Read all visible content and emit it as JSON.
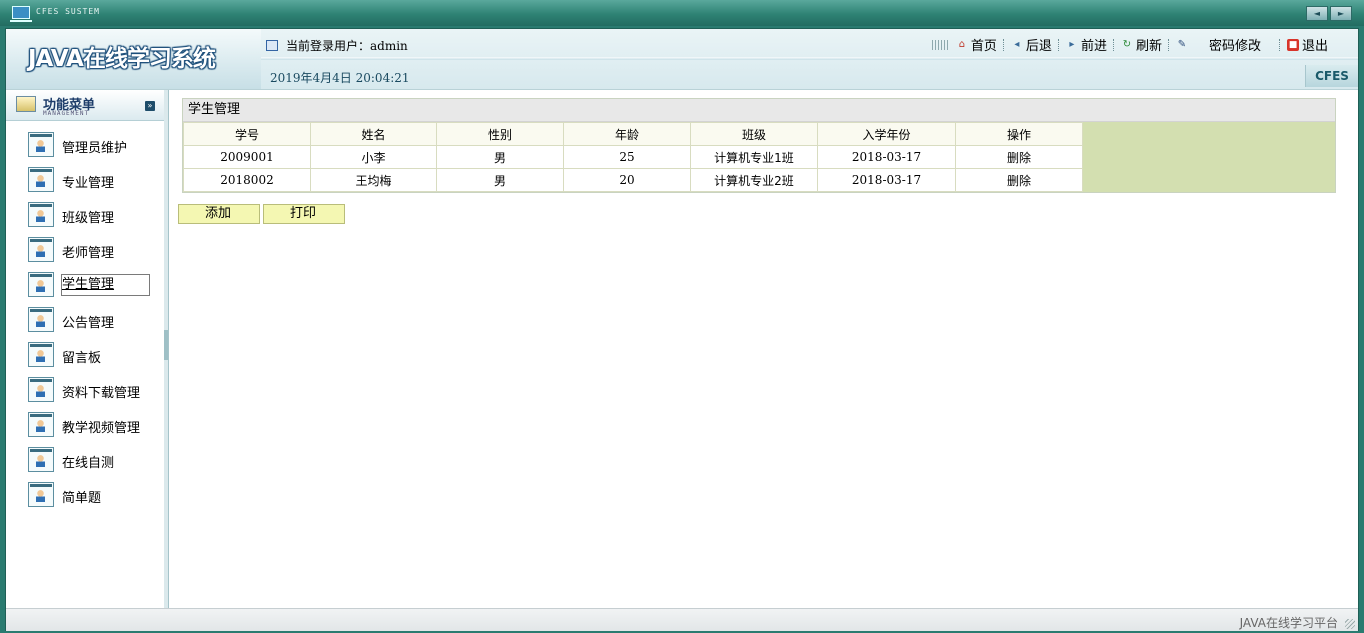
{
  "window": {
    "title": "CFES SUSTEM",
    "nav_buttons": [
      "◄",
      "►"
    ]
  },
  "header": {
    "logo": "JAVA在线学习系统",
    "current_user_label": "当前登录用户：admin",
    "date": "2019年4月4日  20:04:21",
    "brand_tag": "CFES",
    "toolbar": {
      "home": "首页",
      "back": "后退",
      "forward": "前进",
      "refresh": "刷新",
      "change_password": "密码修改",
      "logout": "退出"
    }
  },
  "sidebar": {
    "title": "功能菜单",
    "subtitle": "MANAGEMENT",
    "toggle": "»",
    "items": [
      {
        "label": "管理员维护"
      },
      {
        "label": "专业管理"
      },
      {
        "label": "班级管理"
      },
      {
        "label": "老师管理"
      },
      {
        "label": "学生管理"
      },
      {
        "label": "公告管理"
      },
      {
        "label": "留言板"
      },
      {
        "label": "资料下载管理"
      },
      {
        "label": "教学视频管理"
      },
      {
        "label": "在线自测"
      },
      {
        "label": "简单题"
      }
    ]
  },
  "main": {
    "panel_title": "学生管理",
    "table": {
      "columns": [
        "学号",
        "姓名",
        "性别",
        "年龄",
        "班级",
        "入学年份",
        "操作"
      ],
      "rows": [
        [
          "2009001",
          "小李",
          "男",
          "25",
          "计算机专业1班",
          "2018-03-17",
          "删除"
        ],
        [
          "2018002",
          "王均梅",
          "男",
          "20",
          "计算机专业2班",
          "2018-03-17",
          "删除"
        ]
      ]
    },
    "buttons": {
      "add": "添加",
      "print": "打印"
    }
  },
  "statusbar": {
    "text": "JAVA在线学习平台"
  },
  "colors": {
    "chrome": "#2a7b70",
    "table_filler": "#d3dfb0",
    "button_bg": "#f4f7b2"
  }
}
